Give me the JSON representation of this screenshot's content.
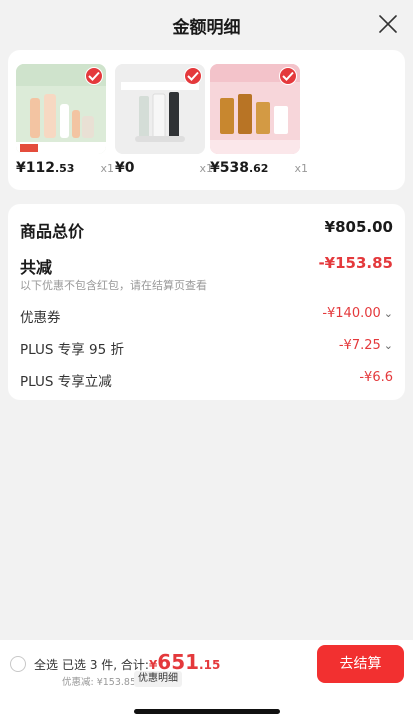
{
  "header": {
    "title": "金额明细",
    "close_icon": "close-icon"
  },
  "products": [
    {
      "price_int": "¥112",
      "price_dec": ".53",
      "qty": "x1",
      "thumb_colors": [
        "#dfeede",
        "#f2c9a8"
      ],
      "checked": true
    },
    {
      "price_int": "¥0",
      "price_dec": "",
      "qty": "x1",
      "thumb_colors": [
        "#f1f1f1",
        "#cfd8d3"
      ],
      "checked": true
    },
    {
      "price_int": "¥538",
      "price_dec": ".62",
      "qty": "x1",
      "thumb_colors": [
        "#f7d6da",
        "#c8872f"
      ],
      "checked": true
    }
  ],
  "summary": {
    "total_label": "商品总价",
    "total_value": "¥805.00",
    "reduce_label": "共减",
    "reduce_value": "-¥153.85",
    "note": "以下优惠不包含红包，请在结算页查看",
    "items": [
      {
        "label": "优惠券",
        "value": "-¥140.00",
        "chevron": "⌄"
      },
      {
        "label": "PLUS 专享 95 折",
        "value": "-¥7.25",
        "chevron": "⌄"
      },
      {
        "label": "PLUS 专享立减",
        "value": "-¥6.6",
        "chevron": ""
      }
    ]
  },
  "footer": {
    "select_all": "全选",
    "selected_prefix": "已选 3 件, 合计:",
    "pay_yen": "¥",
    "pay_int": "651",
    "pay_dec": ".15",
    "discount_text": "优惠减: ¥153.85",
    "detail_button": "优惠明细",
    "checkout_button": "去结算"
  },
  "colors": {
    "accent": "#e4393c",
    "checkout": "#f23030"
  }
}
